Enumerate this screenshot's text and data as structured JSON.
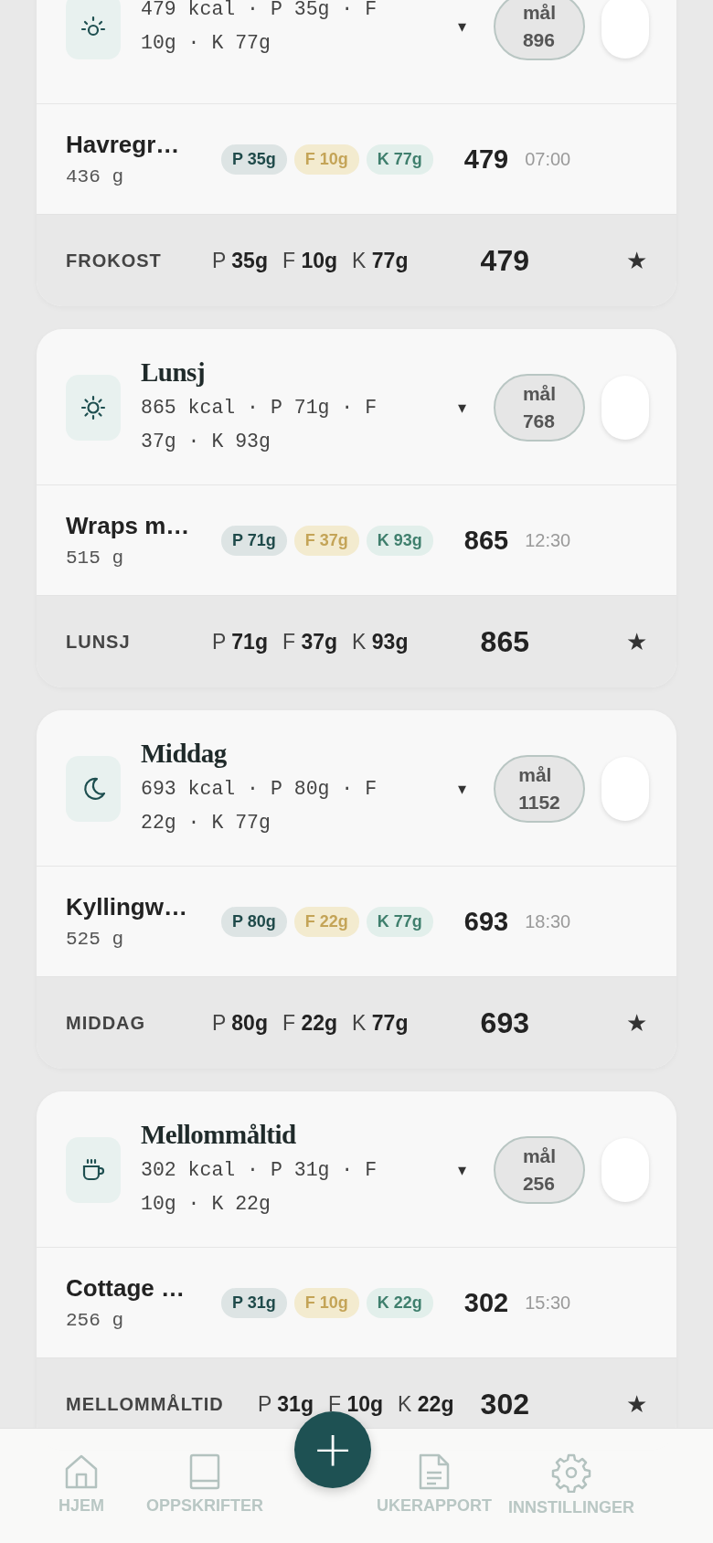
{
  "meals": [
    {
      "kind": "breakfast",
      "on": false,
      "summary": "479 kcal · P 35g · F 10g · K 77g",
      "goal_label": "mål",
      "goal_value": "896",
      "food": {
        "name": "Havregr…",
        "weight": "436 g",
        "chips": [
          {
            "kind": "protein",
            "text": "P 35g"
          },
          {
            "kind": "fat",
            "text": "F 10g"
          },
          {
            "kind": "carbs",
            "text": "K 77g"
          }
        ],
        "kcal": "479",
        "time": "07:00"
      },
      "footer": {
        "label": "FROKOST",
        "macros": [
          "P **35g**",
          "F **10g**",
          "K **77g**"
        ],
        "total": "479",
        "star": "★"
      }
    },
    {
      "kind": "lunch",
      "on": false,
      "title": "Lunsj",
      "summary": "865 kcal · P 71g · F 37g · K 93g",
      "goal_label": "mål",
      "goal_value": "768",
      "food": {
        "name": "Wraps m…",
        "weight": "515 g",
        "chips": [
          {
            "kind": "protein",
            "text": "P 71g"
          },
          {
            "kind": "fat",
            "text": "F 37g"
          },
          {
            "kind": "carbs",
            "text": "K 93g"
          }
        ],
        "kcal": "865",
        "time": "12:30"
      },
      "footer": {
        "label": "LUNSJ",
        "macros": [
          "P **71g**",
          "F **37g**",
          "K **93g**"
        ],
        "total": "865",
        "star": "★"
      }
    },
    {
      "kind": "dinner",
      "on": false,
      "title": "Middag",
      "summary": "693 kcal · P 80g · F 22g · K 77g",
      "goal_label": "mål",
      "goal_value": "1152",
      "food": {
        "name": "Kyllingw…",
        "weight": "525 g",
        "chips": [
          {
            "kind": "protein",
            "text": "P 80g"
          },
          {
            "kind": "fat",
            "text": "F 22g"
          },
          {
            "kind": "carbs",
            "text": "K 77g"
          }
        ],
        "kcal": "693",
        "time": "18:30"
      },
      "footer": {
        "label": "MIDDAG",
        "macros": [
          "P **80g**",
          "F **22g**",
          "K **77g**"
        ],
        "total": "693",
        "star": "★"
      }
    },
    {
      "kind": "snack",
      "on": false,
      "title": "Mellommåltid",
      "summary": "302 kcal · P 31g · F 10g · K 22g",
      "goal_label": "mål",
      "goal_value": "256",
      "food": {
        "name": "Cottage …",
        "weight": "256 g",
        "chips": [
          {
            "kind": "protein",
            "text": "P 31g"
          },
          {
            "kind": "fat",
            "text": "F 10g"
          },
          {
            "kind": "carbs",
            "text": "K 22g"
          }
        ],
        "kcal": "302",
        "time": "15:30"
      },
      "footer": {
        "label": "MELLOMMÅLTID",
        "macros": [
          "P **31g**",
          "F **10g**",
          "K **22g**"
        ],
        "total": "302",
        "star": "★"
      }
    }
  ],
  "caret": "▾",
  "add_button": "+",
  "nav": [
    {
      "kind": "home",
      "label": "HJEM"
    },
    {
      "kind": "recipes",
      "label": "OPPSKRIFTER"
    },
    {
      "kind": "report",
      "label": "UKERAPPORT"
    },
    {
      "kind": "settings",
      "label": "INNSTILLINGER"
    }
  ]
}
